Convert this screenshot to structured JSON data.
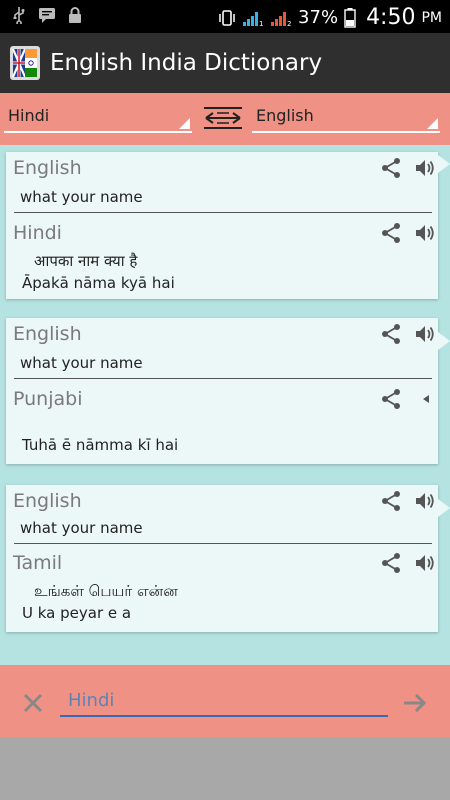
{
  "status_bar": {
    "icons_left": [
      "usb-icon",
      "message-icon",
      "lock-icon"
    ],
    "icons_right": [
      "vibrate-icon",
      "signal-1-icon",
      "signal-2-icon",
      "battery-icon"
    ],
    "battery": "37%",
    "time": "4:50",
    "ampm": "PM"
  },
  "app_bar": {
    "title": "English India Dictionary",
    "logo": "uk-india-flag-icon"
  },
  "lang_bar": {
    "from_lang": "Hindi",
    "to_lang": "English",
    "swap_icon": "swap-arrows-icon"
  },
  "cards": [
    {
      "source_lang": "English",
      "source_text": "what your name",
      "target_lang": "Hindi",
      "native_text": "आपका नाम क्या है",
      "translit_text": "Āpakā nāma kyā hai"
    },
    {
      "source_lang": "English",
      "source_text": "what your name",
      "target_lang": "Punjabi",
      "native_text": "",
      "translit_text": "Tuhā ē nāmma kī hai"
    },
    {
      "source_lang": "English",
      "source_text": "what your name",
      "target_lang": "Tamil",
      "native_text": "உங்கள் பெயர் என்ன",
      "translit_text": "U ka  peyar e  a"
    }
  ],
  "bottom_bar": {
    "input_placeholder": "Hindi",
    "input_value": "",
    "close_icon": "close-icon",
    "go_icon": "arrow-right-icon"
  },
  "colors": {
    "accent_salmon": "#ef9184",
    "content_bg": "#b5e3e1",
    "card_bg": "#ecf8f8",
    "app_bar": "#2f2f2f",
    "input_underline": "#3a6ab6"
  }
}
